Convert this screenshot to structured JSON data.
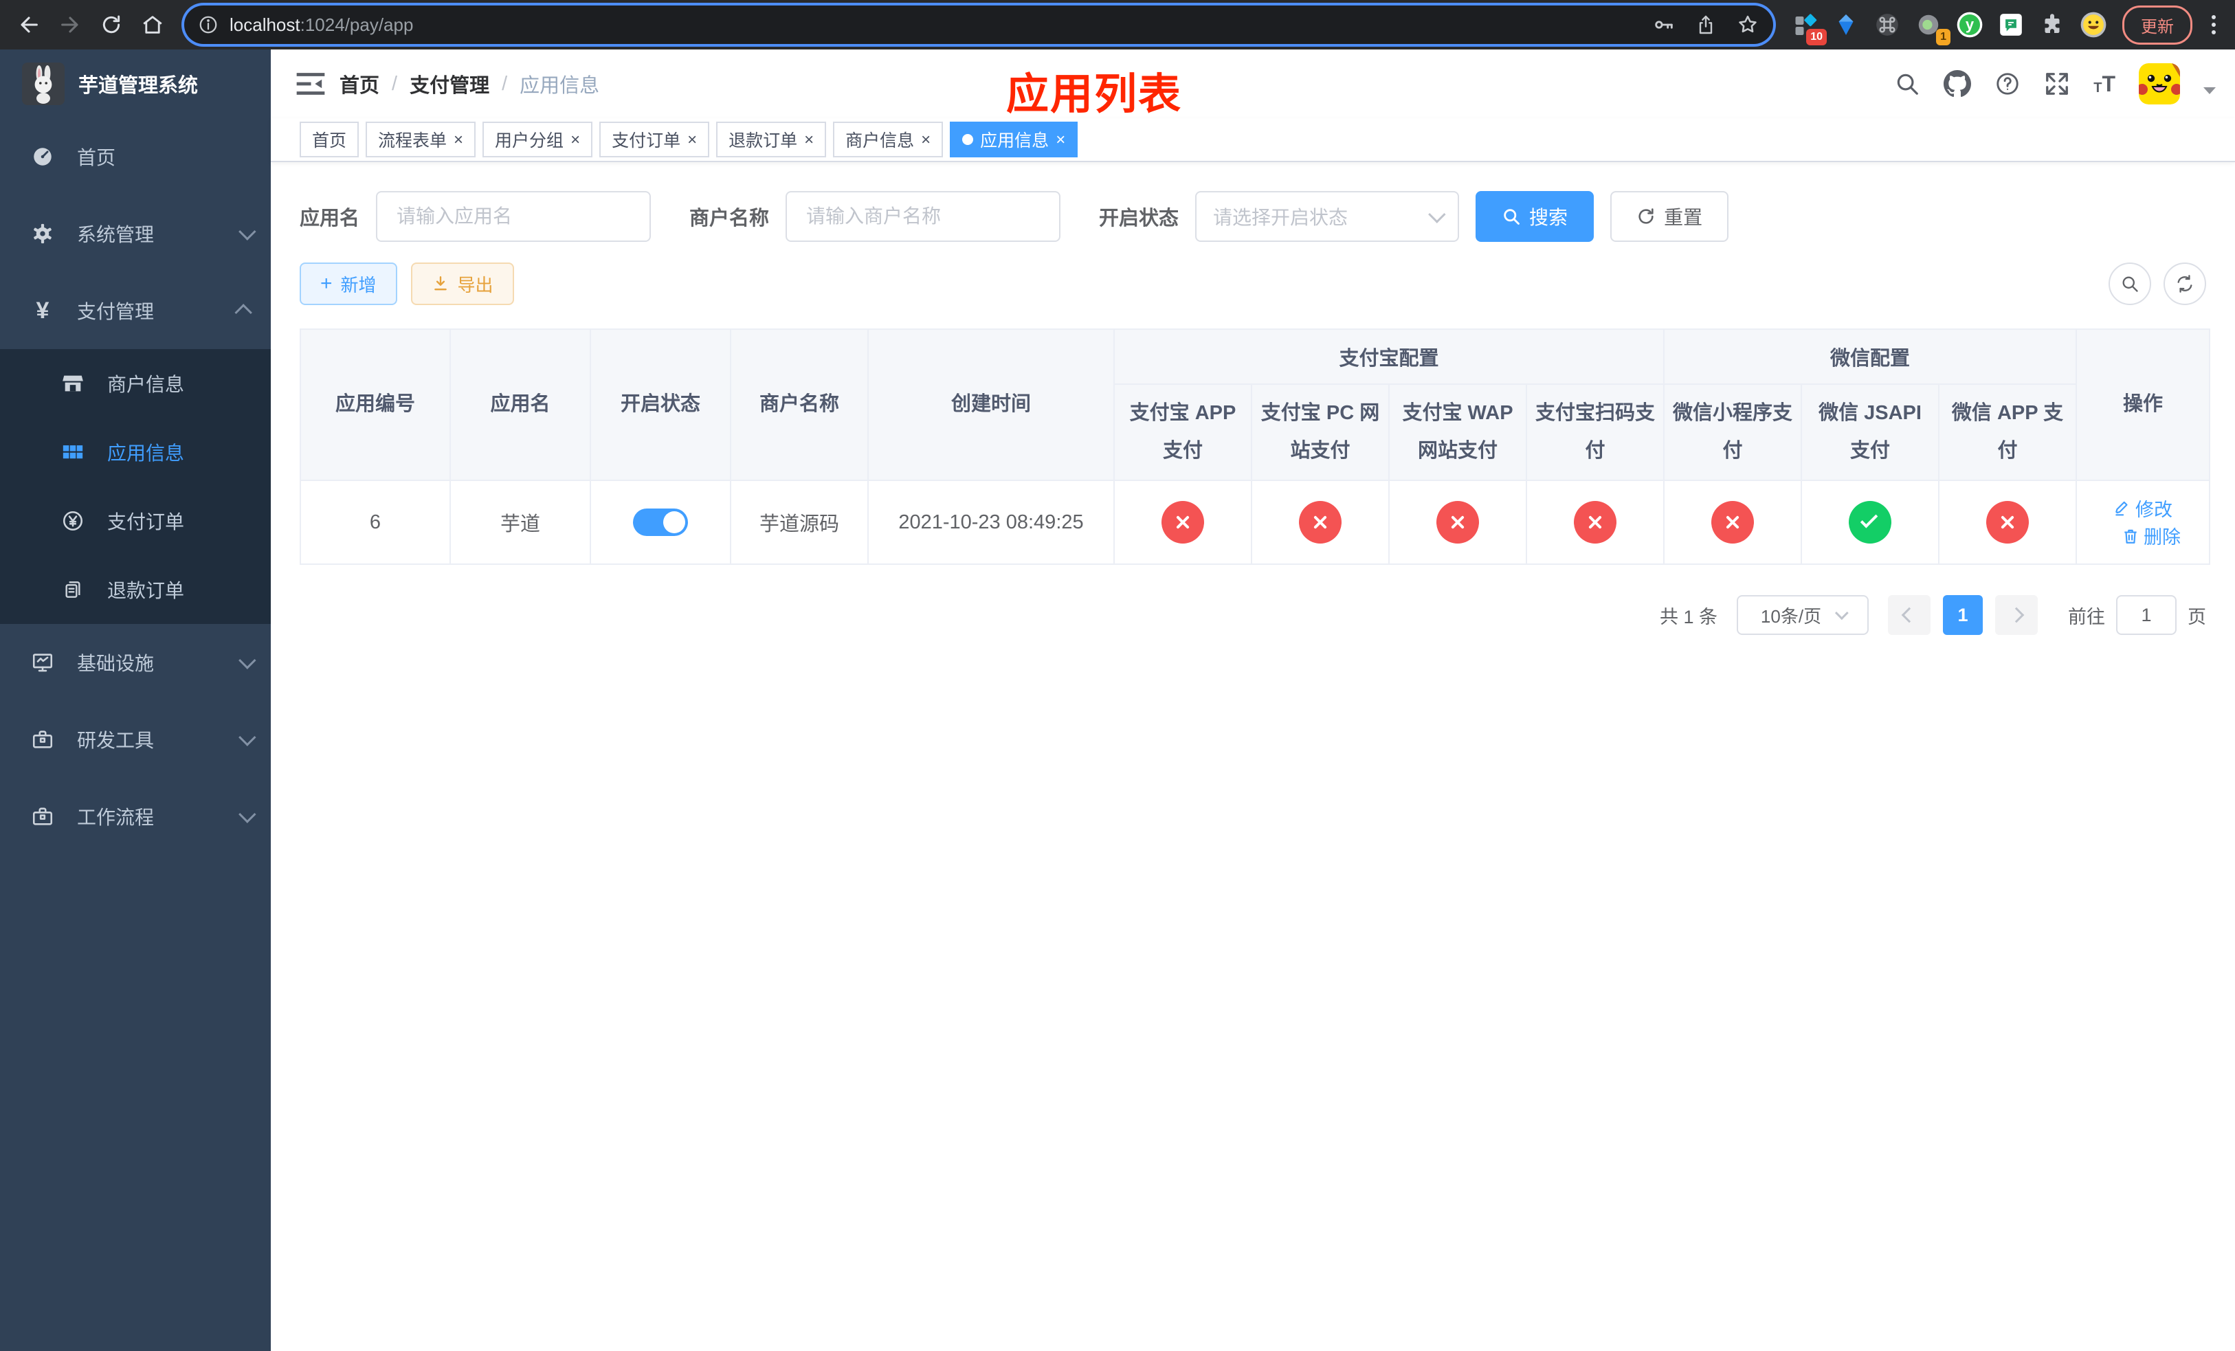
{
  "browser": {
    "url_host": "localhost",
    "url_rest": ":1024/pay/app",
    "update_label": "更新",
    "ext1_badge": "10",
    "ext2_badge": "1",
    "ext_y_label": "y"
  },
  "sidebar": {
    "title": "芋道管理系统",
    "items": [
      {
        "label": "首页"
      },
      {
        "label": "系统管理"
      },
      {
        "label": "支付管理",
        "expanded": true,
        "children": [
          {
            "label": "商户信息"
          },
          {
            "label": "应用信息",
            "active": true
          },
          {
            "label": "支付订单"
          },
          {
            "label": "退款订单"
          }
        ]
      },
      {
        "label": "基础设施"
      },
      {
        "label": "研发工具"
      },
      {
        "label": "工作流程"
      }
    ]
  },
  "header": {
    "breadcrumb": [
      "首页",
      "支付管理",
      "应用信息"
    ],
    "page_title": "应用列表"
  },
  "tabs": [
    {
      "label": "首页",
      "closable": false,
      "active": false
    },
    {
      "label": "流程表单",
      "closable": true,
      "active": false
    },
    {
      "label": "用户分组",
      "closable": true,
      "active": false
    },
    {
      "label": "支付订单",
      "closable": true,
      "active": false
    },
    {
      "label": "退款订单",
      "closable": true,
      "active": false
    },
    {
      "label": "商户信息",
      "closable": true,
      "active": false
    },
    {
      "label": "应用信息",
      "closable": true,
      "active": true
    }
  ],
  "filters": {
    "app_name_label": "应用名",
    "app_name_placeholder": "请输入应用名",
    "merchant_label": "商户名称",
    "merchant_placeholder": "请输入商户名称",
    "status_label": "开启状态",
    "status_placeholder": "请选择开启状态",
    "search_label": "搜索",
    "reset_label": "重置"
  },
  "toolbar": {
    "add_label": "新增",
    "export_label": "导出"
  },
  "table": {
    "col_app_id": "应用编号",
    "col_app_name": "应用名",
    "col_status": "开启状态",
    "col_merchant": "商户名称",
    "col_created": "创建时间",
    "group_alipay": "支付宝配置",
    "group_wechat": "微信配置",
    "alipay_cols": [
      "支付宝 APP 支付",
      "支付宝 PC 网站支付",
      "支付宝 WAP 网站支付",
      "支付宝扫码支付"
    ],
    "wechat_cols": [
      "微信小程序支付",
      "微信 JSAPI 支付",
      "微信 APP 支付"
    ],
    "col_actions": "操作",
    "rows": [
      {
        "id": "6",
        "name": "芋道",
        "enabled": true,
        "merchant": "芋道源码",
        "created": "2021-10-23 08:49:25",
        "pay_status": [
          false,
          false,
          false,
          false,
          false,
          true,
          false
        ],
        "edit_label": "修改",
        "delete_label": "删除"
      }
    ]
  },
  "pagination": {
    "total": "共 1 条",
    "page_size": "10条/页",
    "current_page": "1",
    "goto_label": "前往",
    "goto_value": "1",
    "page_unit": "页"
  },
  "colors": {
    "accent": "#409eff",
    "danger": "#f45353",
    "success": "#13ce66",
    "warning": "#e6a23c",
    "title_red": "#ff2600"
  }
}
